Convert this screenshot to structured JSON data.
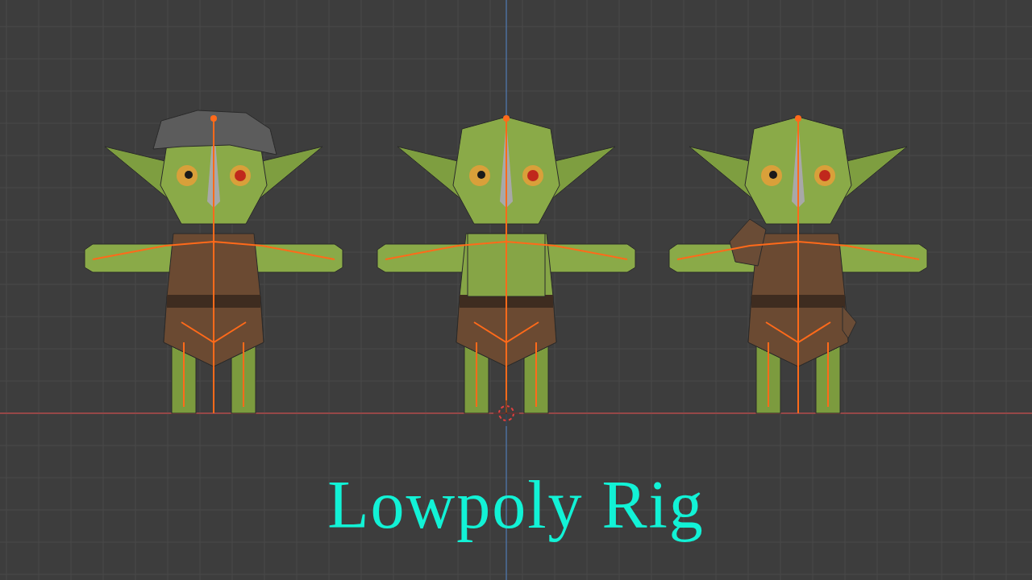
{
  "viewport": {
    "figures": [
      {
        "kind": "capped"
      },
      {
        "kind": "bare"
      },
      {
        "kind": "armored"
      }
    ]
  },
  "title": "Lowpoly Rig"
}
